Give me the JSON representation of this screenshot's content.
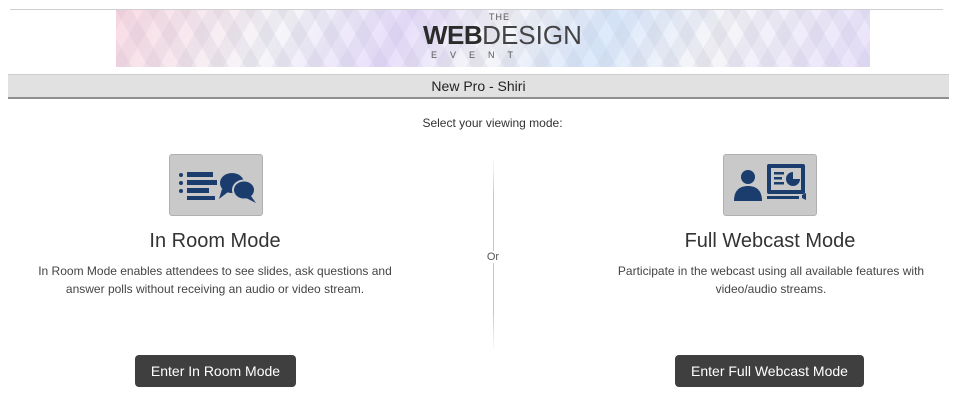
{
  "logo": {
    "the": "THE",
    "web": "WEB",
    "design": "DESIGN",
    "event": "EVENT"
  },
  "page_title": "New Pro - Shiri",
  "prompt": "Select your viewing mode:",
  "divider_label": "Or",
  "modes": [
    {
      "icon": "chat-bubbles-list-icon",
      "title": "In Room Mode",
      "description": "In Room Mode enables attendees to see slides, ask questions and answer polls without receiving an audio or video stream.",
      "button": "Enter In Room Mode"
    },
    {
      "icon": "presenter-webcast-icon",
      "title": "Full Webcast Mode",
      "description": "Participate in the webcast using all available features with video/audio streams.",
      "button": "Enter Full Webcast Mode"
    }
  ],
  "colors": {
    "button_bg": "#3f3f3f",
    "icon_tile": "#c9c9c9",
    "icon_blue": "#1a3d6e"
  }
}
